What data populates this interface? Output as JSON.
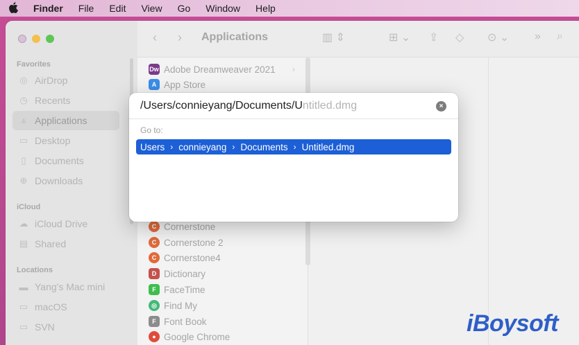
{
  "menubar": {
    "items": [
      "Finder",
      "File",
      "Edit",
      "View",
      "Go",
      "Window",
      "Help"
    ]
  },
  "toolbar": {
    "title": "Applications"
  },
  "sidebar": {
    "favorites_heading": "Favorites",
    "favorites": [
      "AirDrop",
      "Recents",
      "Applications",
      "Desktop",
      "Documents",
      "Downloads"
    ],
    "icloud_heading": "iCloud",
    "icloud": [
      "iCloud Drive",
      "Shared"
    ],
    "locations_heading": "Locations",
    "locations": [
      "Yang's Mac mini",
      "macOS",
      "SVN"
    ]
  },
  "apps": {
    "top": [
      {
        "name": "Adobe Dreamweaver 2021",
        "icon": "Dw",
        "color": "#7a3b8a"
      },
      {
        "name": "App Store",
        "icon": "A",
        "color": "#3b8ee8"
      }
    ],
    "bottom": [
      {
        "name": "Cornerstone",
        "icon": "C",
        "color": "#e06a3b"
      },
      {
        "name": "Cornerstone 2",
        "icon": "C",
        "color": "#e06a3b"
      },
      {
        "name": "Cornerstone4",
        "icon": "C",
        "color": "#e06a3b"
      },
      {
        "name": "Dictionary",
        "icon": "D",
        "color": "#c4524c"
      },
      {
        "name": "FaceTime",
        "icon": "F",
        "color": "#3fbe4f"
      },
      {
        "name": "Find My",
        "icon": "◎",
        "color": "#44b87a"
      },
      {
        "name": "Font Book",
        "icon": "F",
        "color": "#8c8c8c"
      },
      {
        "name": "Google Chrome",
        "icon": "●",
        "color": "#e04c3b"
      }
    ]
  },
  "goto_dialog": {
    "typed": "/Users/connieyang/Documents/U",
    "suggestion": "ntitled.dmg",
    "label": "Go to:",
    "path_segments": [
      "Users",
      "connieyang",
      "Documents",
      "Untitled.dmg"
    ],
    "path_separator": "›",
    "clear_icon": "×"
  },
  "watermark": {
    "text": "iBoysoft"
  }
}
